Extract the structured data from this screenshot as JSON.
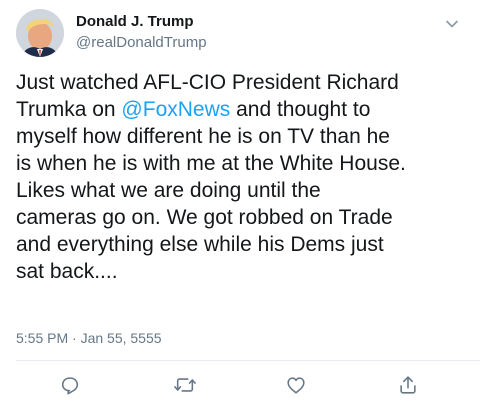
{
  "author": {
    "display_name": "Donald J. Trump",
    "handle": "@realDonaldTrump"
  },
  "tweet": {
    "lines": [
      {
        "before": "Just watched AFL-CIO President Richard",
        "mention": "",
        "after": ""
      },
      {
        "before": "Trumka on ",
        "mention": "@FoxNews",
        "after": " and thought to"
      },
      {
        "before": "myself how different he is on TV than he",
        "mention": "",
        "after": ""
      },
      {
        "before": "is when he is with me at the White House.",
        "mention": "",
        "after": ""
      },
      {
        "before": "Likes what we are doing until the",
        "mention": "",
        "after": ""
      },
      {
        "before": "cameras go on. We got robbed on Trade",
        "mention": "",
        "after": ""
      },
      {
        "before": "and everything else while his Dems just",
        "mention": "",
        "after": ""
      },
      {
        "before": "sat back....",
        "mention": "",
        "after": ""
      }
    ],
    "timestamp": "5:55 PM · Jan 55, 5555"
  },
  "icons": {
    "more": "chevron-down-icon",
    "reply": "reply-icon",
    "retweet": "retweet-icon",
    "like": "heart-icon",
    "share": "share-icon"
  },
  "colors": {
    "text": "#14171a",
    "secondary": "#657786",
    "link": "#1da1f2",
    "divider": "#e6ecf0"
  }
}
